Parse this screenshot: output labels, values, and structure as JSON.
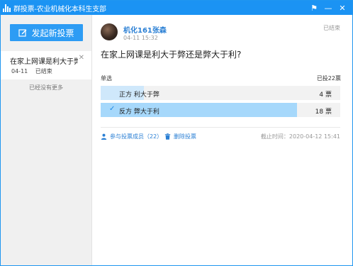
{
  "window": {
    "title": "群投票-农业机械化本科生支部",
    "controls": {
      "pin": "⚑",
      "minimize": "—",
      "close": "✕"
    }
  },
  "sidebar": {
    "new_vote_label": "发起新投票",
    "items": [
      {
        "title": "在家上网课是利大于弊...",
        "date": "04-11",
        "status": "已结束"
      }
    ],
    "no_more": "已经没有更多"
  },
  "detail": {
    "author": "机化161张森",
    "time": "04-11 15:32",
    "status": "已结束",
    "question": "在家上网课是利大于弊还是弊大于利?",
    "vote_type": "单选",
    "total": "已投22票",
    "options": [
      {
        "label": "正方 利大于弊",
        "count": "4 票",
        "votes": 4,
        "selected": false
      },
      {
        "label": "反方 弊大于利",
        "count": "18 票",
        "votes": 18,
        "selected": true
      }
    ],
    "participants_label": "参与投票成员（22）",
    "delete_label": "删除投票",
    "deadline": "截止时间：2020-04-12 15:41"
  },
  "colors": {
    "title_bar": "#1b93f3",
    "accent": "#2d9cf4",
    "link": "#2a7fd4",
    "bar_fill": "#cfe8fb",
    "bar_fill_selected": "#a6d8fb"
  }
}
